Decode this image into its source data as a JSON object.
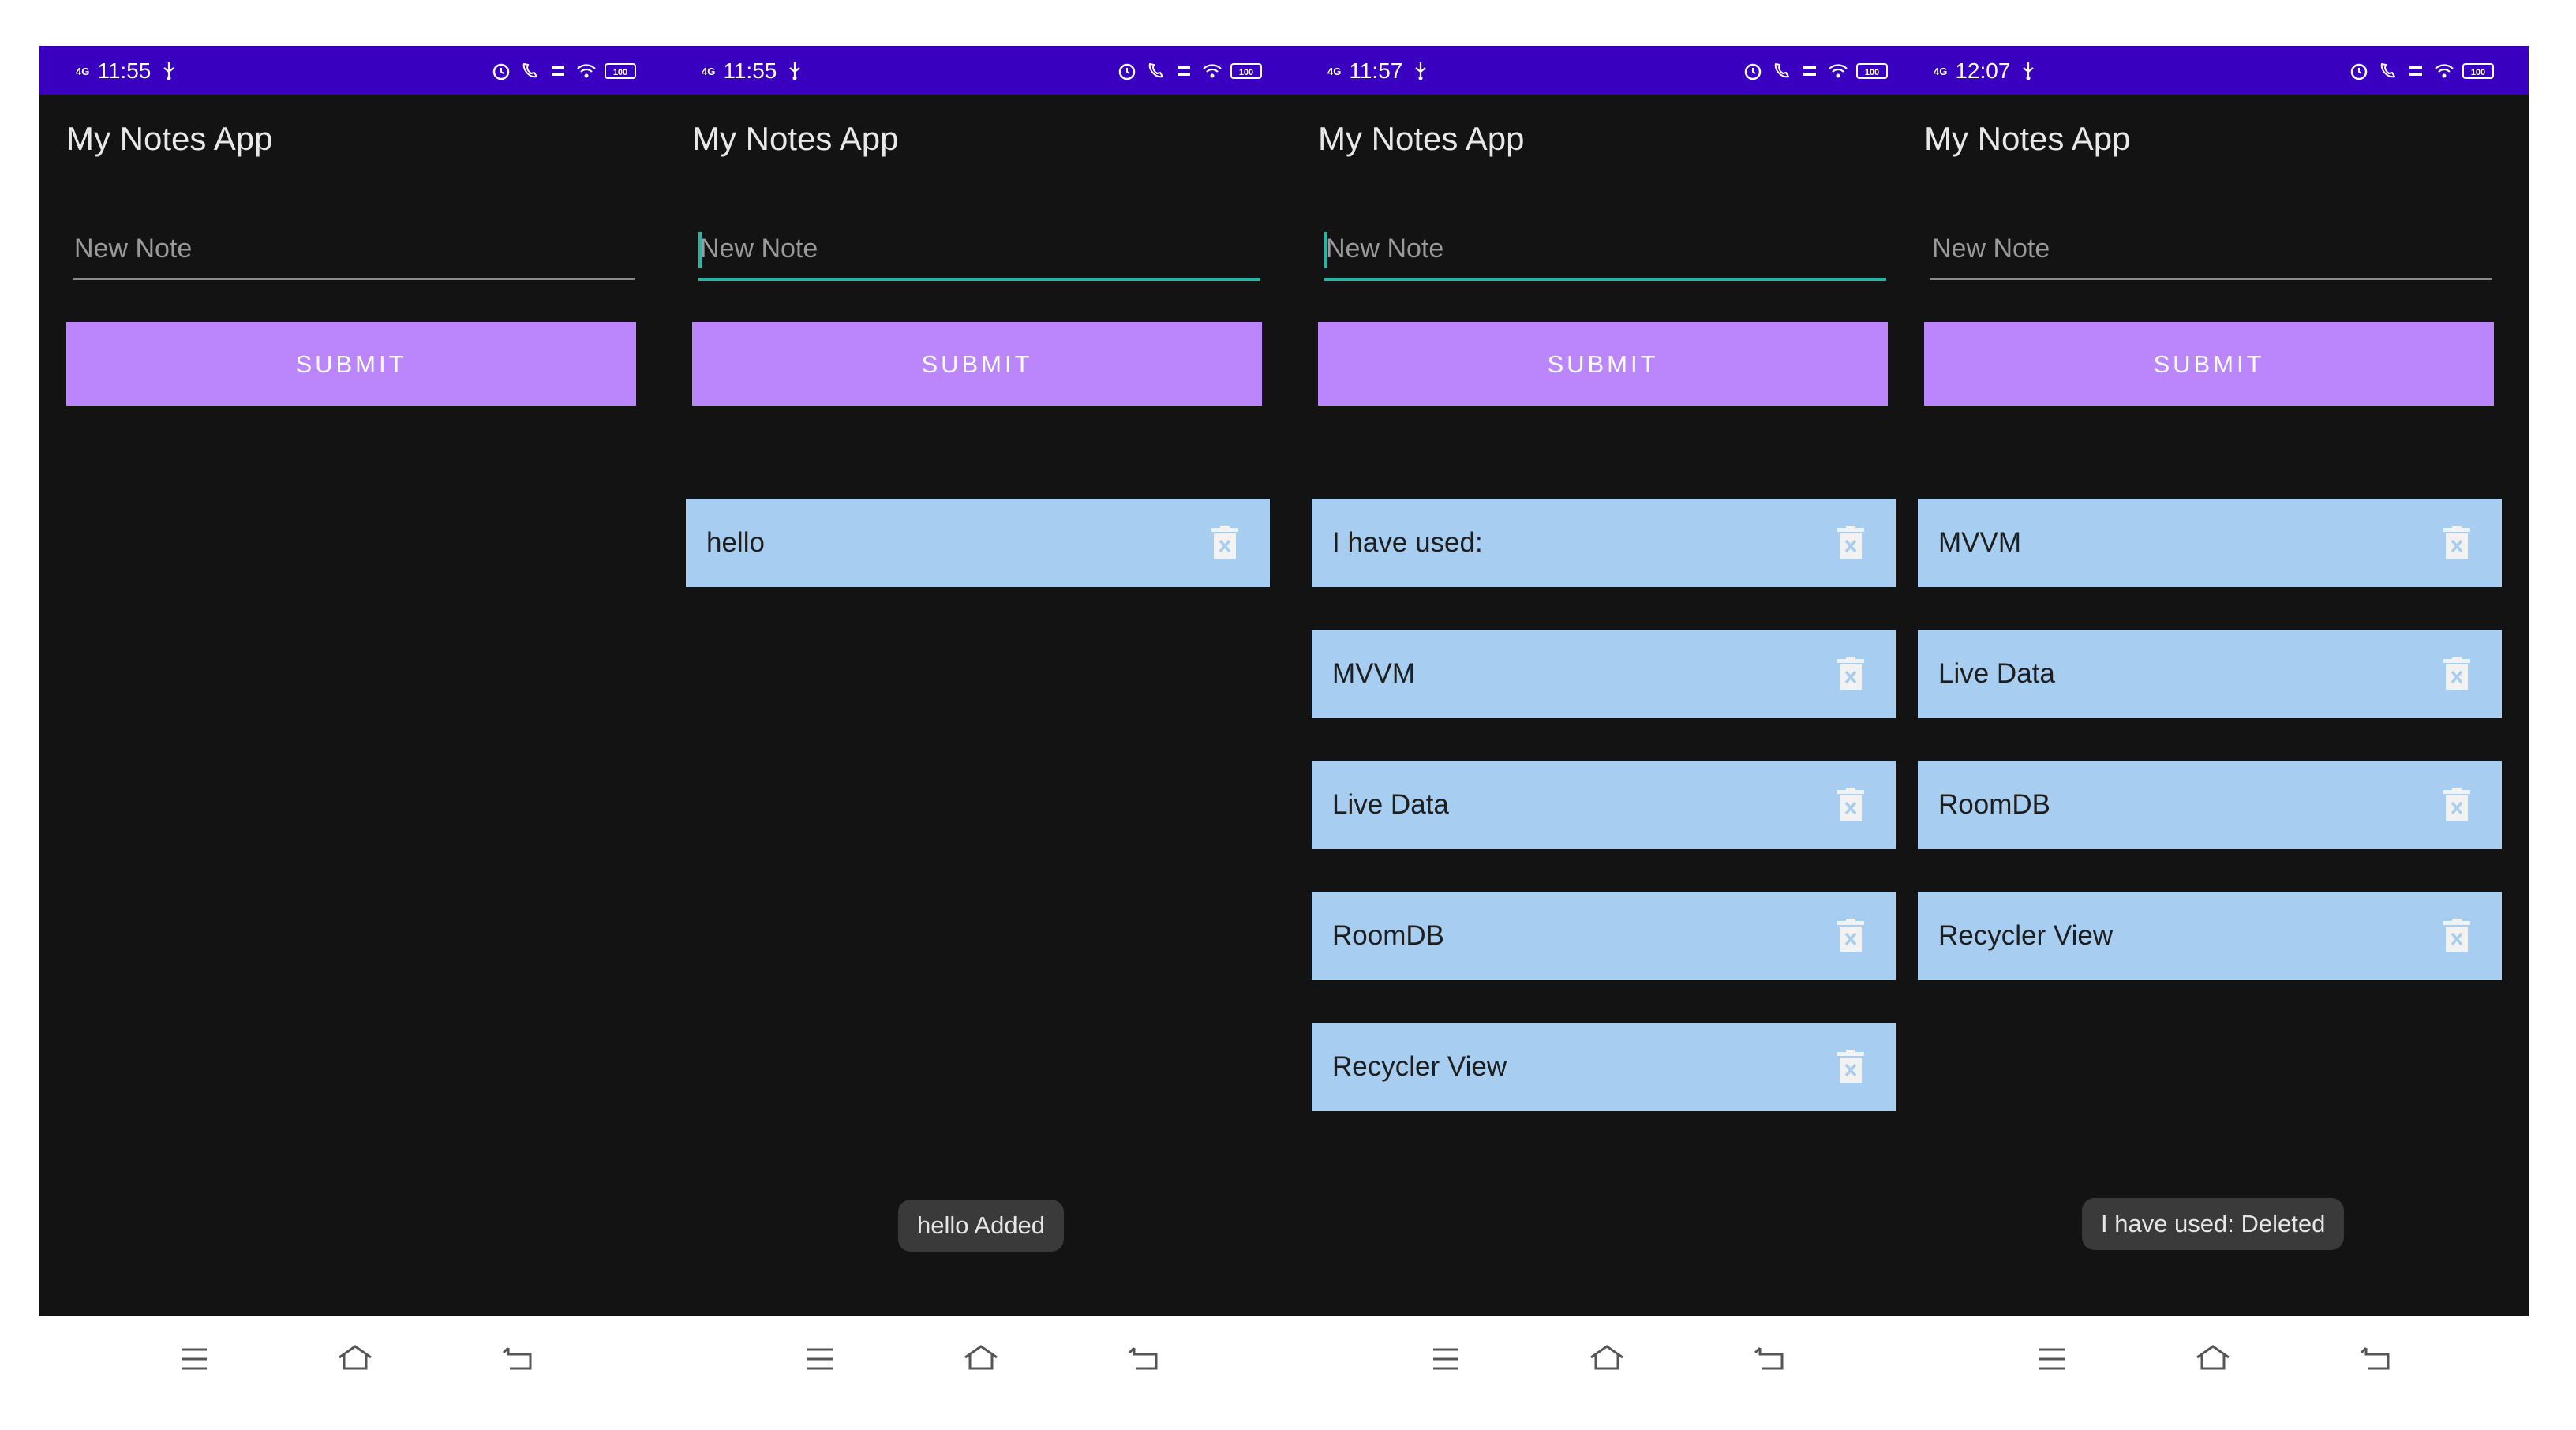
{
  "screens": [
    {
      "status": {
        "time": "11:55",
        "signal": "4G"
      },
      "app_title": "My Notes App",
      "input": {
        "placeholder": "New Note",
        "focused": false
      },
      "submit_label": "SUBMIT",
      "notes": [],
      "toast": null
    },
    {
      "status": {
        "time": "11:55",
        "signal": "4G"
      },
      "app_title": "My Notes App",
      "input": {
        "placeholder": "New Note",
        "focused": true
      },
      "submit_label": "SUBMIT",
      "notes": [
        "hello"
      ],
      "toast": "hello Added"
    },
    {
      "status": {
        "time": "11:57",
        "signal": "4G"
      },
      "app_title": "My Notes App",
      "input": {
        "placeholder": "New Note",
        "focused": true
      },
      "submit_label": "SUBMIT",
      "notes": [
        "I have used:",
        "MVVM",
        "Live Data",
        "RoomDB",
        "Recycler View"
      ],
      "toast": null
    },
    {
      "status": {
        "time": "12:07",
        "signal": "4G"
      },
      "app_title": "My Notes App",
      "input": {
        "placeholder": "New Note",
        "focused": false
      },
      "submit_label": "SUBMIT",
      "notes": [
        "MVVM",
        "Live Data",
        "RoomDB",
        "Recycler View"
      ],
      "toast": "I have used: Deleted"
    }
  ],
  "battery_label": "100",
  "icons": {
    "delete": "trash-icon",
    "nav_menu": "menu-icon",
    "nav_home": "home-icon",
    "nav_back": "back-icon"
  },
  "colors": {
    "status_bar": "#3a00c0",
    "background": "#131313",
    "submit": "#bb86fc",
    "note_card": "#a7cdf0",
    "focus_accent": "#26b6a6",
    "toast": "#3a3a3a"
  }
}
